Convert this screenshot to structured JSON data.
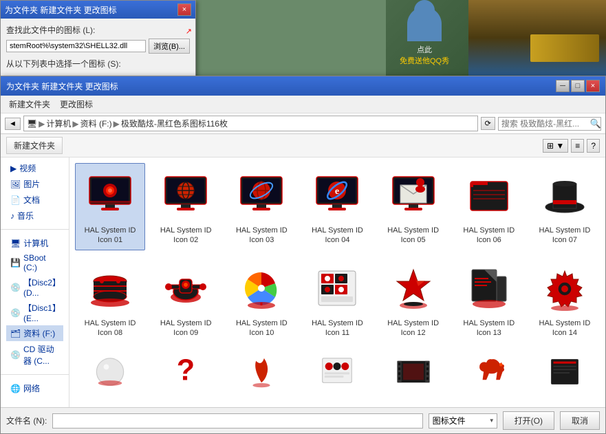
{
  "bg_dialog": {
    "title": "为文件夹 新建文件夹 更改图标",
    "close_btn": "×",
    "label1": "查找此文件中的图标 (L):",
    "input_value": "stemRoot%\\system32\\SHELL32.dll",
    "browse_label": "浏览(B)...",
    "label2": "从以下列表中选择一个图标 (S):"
  },
  "main_window": {
    "title": "为文件夹 新建文件夹 更改图标",
    "close_btn": "×",
    "menu_items": [
      "新建文件夹",
      "更改图标"
    ],
    "address": {
      "parts": [
        "计算机",
        "资料 (F:)",
        "极致酷炫-黑红色系图标116枚"
      ],
      "search_placeholder": "搜索 极致酷炫-黑红..."
    },
    "toolbar": {
      "new_folder_label": "新建文件夹"
    },
    "sidebar_items": [
      {
        "label": "视频"
      },
      {
        "label": "图片"
      },
      {
        "label": "文档"
      },
      {
        "label": "音乐"
      },
      {
        "divider": true
      },
      {
        "label": "计算机"
      },
      {
        "label": "SBoot (C:)"
      },
      {
        "label": "【Disc2】(D..."
      },
      {
        "label": "【Disc1】(E..."
      },
      {
        "label": "资料 (F:)",
        "selected": true
      },
      {
        "label": "CD 驱动器 (C..."
      },
      {
        "divider": true
      },
      {
        "label": "网络"
      }
    ],
    "icons": [
      {
        "id": "01",
        "label": "HAL System ID Icon 01"
      },
      {
        "id": "02",
        "label": "HAL System ID Icon 02"
      },
      {
        "id": "03",
        "label": "HAL System ID Icon 03"
      },
      {
        "id": "04",
        "label": "HAL System ID Icon 04"
      },
      {
        "id": "05",
        "label": "HAL System ID Icon 05"
      },
      {
        "id": "06",
        "label": "HAL System ID Icon 06"
      },
      {
        "id": "07",
        "label": "HAL System ID Icon 07"
      },
      {
        "id": "08",
        "label": "HAL System ID Icon 08"
      },
      {
        "id": "09",
        "label": "HAL System ID Icon 09"
      },
      {
        "id": "10",
        "label": "HAL System ID Icon 10"
      },
      {
        "id": "11",
        "label": "HAL System ID Icon 11"
      },
      {
        "id": "12",
        "label": "HAL System ID Icon 12"
      },
      {
        "id": "13",
        "label": "HAL System ID Icon 13"
      },
      {
        "id": "14",
        "label": "HAL System ID Icon 14"
      }
    ],
    "partial_icons": [
      {
        "id": "15",
        "shape": "sphere"
      },
      {
        "id": "16",
        "shape": "question"
      },
      {
        "id": "17",
        "shape": "plant"
      },
      {
        "id": "18",
        "shape": "items"
      },
      {
        "id": "19",
        "shape": "film"
      },
      {
        "id": "20",
        "shape": "horse"
      },
      {
        "id": "21",
        "shape": "book"
      }
    ],
    "bottom": {
      "filename_label": "文件名 (N):",
      "filename_value": "",
      "filetype_label": "图标文件",
      "open_label": "打开(O)",
      "cancel_label": "取消"
    }
  },
  "colors": {
    "accent_red": "#cc0000",
    "dark_bg": "#1a1a1a",
    "monitor_screen": "#1a1a2e",
    "title_bar_start": "#3a6fd8",
    "title_bar_end": "#2a5ab8",
    "close_btn": "#cc3333"
  }
}
